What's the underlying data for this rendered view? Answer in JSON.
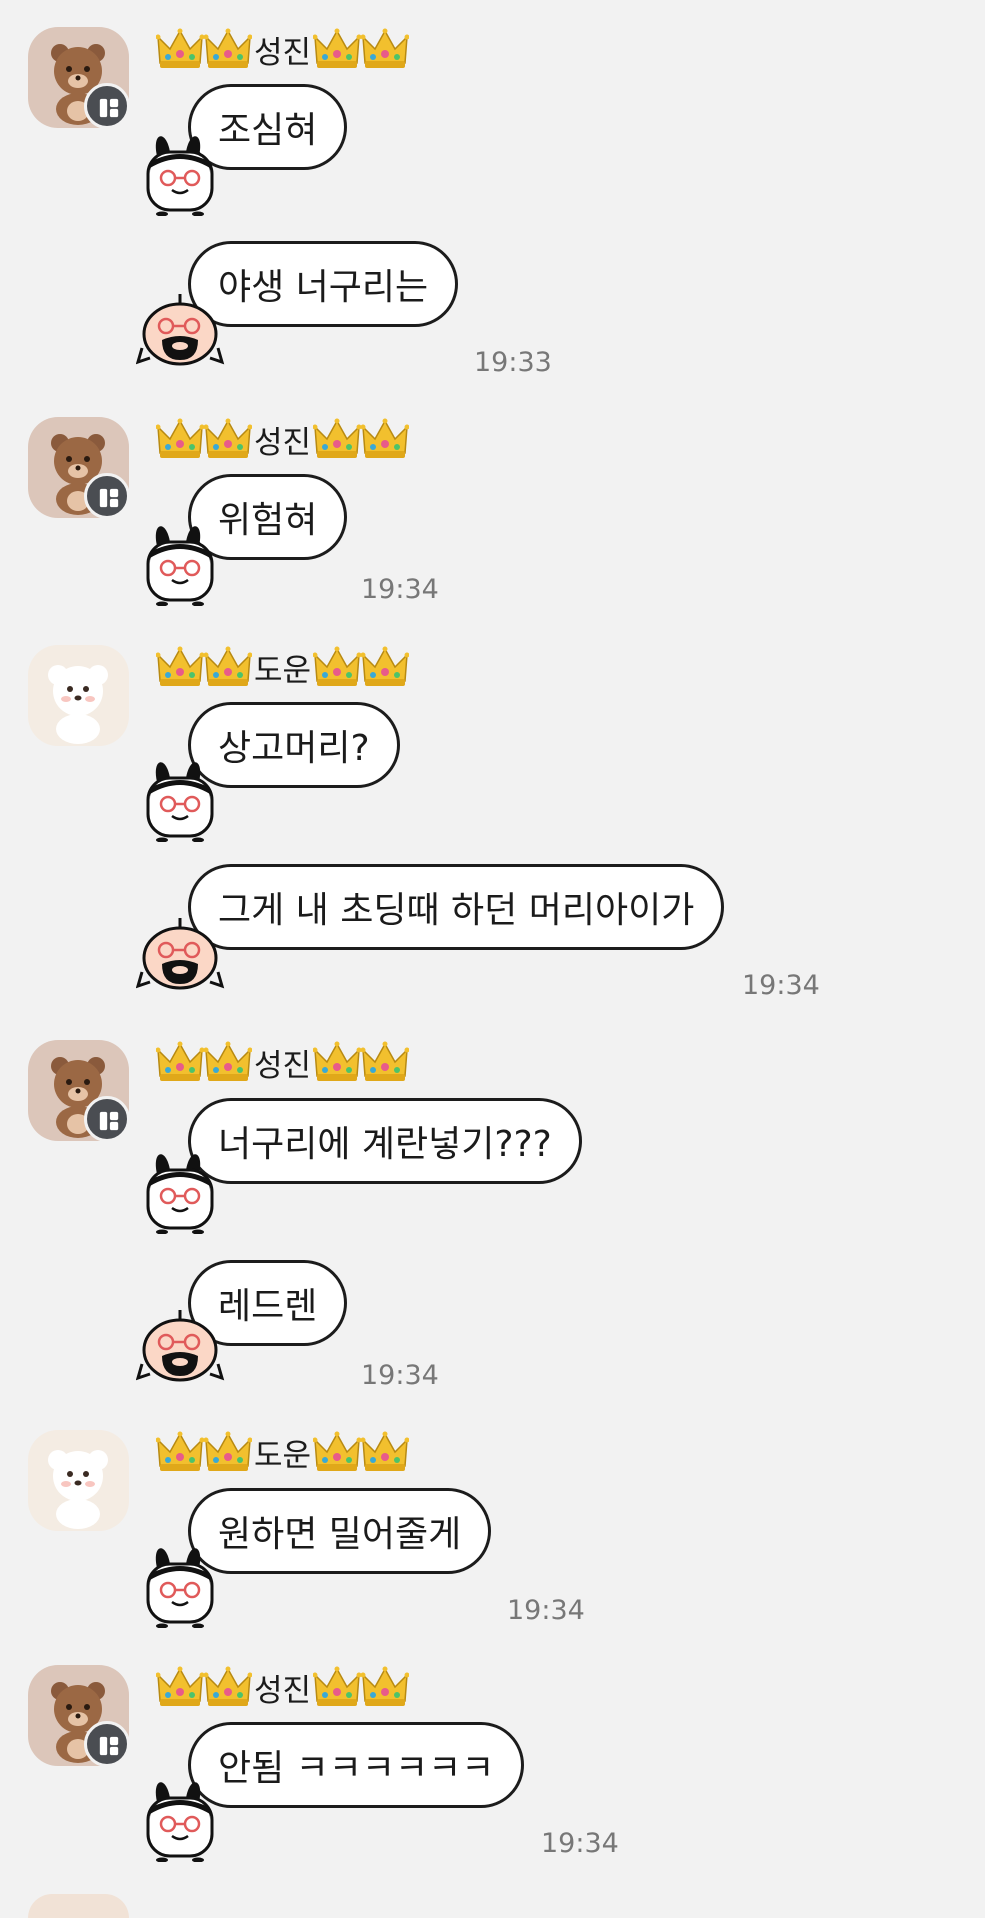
{
  "messages": [
    {
      "sender": "성진",
      "text": "조심혀"
    },
    {
      "text": "야생 너구리는",
      "time": "19:33"
    },
    {
      "sender": "성진",
      "text": "위험혀",
      "time": "19:34"
    },
    {
      "sender": "도운",
      "text": "상고머리?"
    },
    {
      "text": "그게 내 초딩때 하던 머리아이가",
      "time": "19:34"
    },
    {
      "sender": "성진",
      "text": "너구리에 계란넣기???"
    },
    {
      "text": "레드렌",
      "time": "19:34"
    },
    {
      "sender": "도운",
      "text": "원하면 밀어줄게",
      "time": "19:34"
    },
    {
      "sender": "성진",
      "text": "안됨 ㅋㅋㅋㅋㅋㅋ",
      "time": "19:34"
    }
  ],
  "icons": {
    "crown": "crown-icon",
    "bear_avatar": "bear-avatar",
    "dog_avatar": "dog-avatar",
    "badge": "profile-badge-icon"
  },
  "colors": {
    "background": "#f2f2f2",
    "bubble": "#ffffff",
    "bubble_border": "#1c1c1c",
    "time": "#777777"
  }
}
